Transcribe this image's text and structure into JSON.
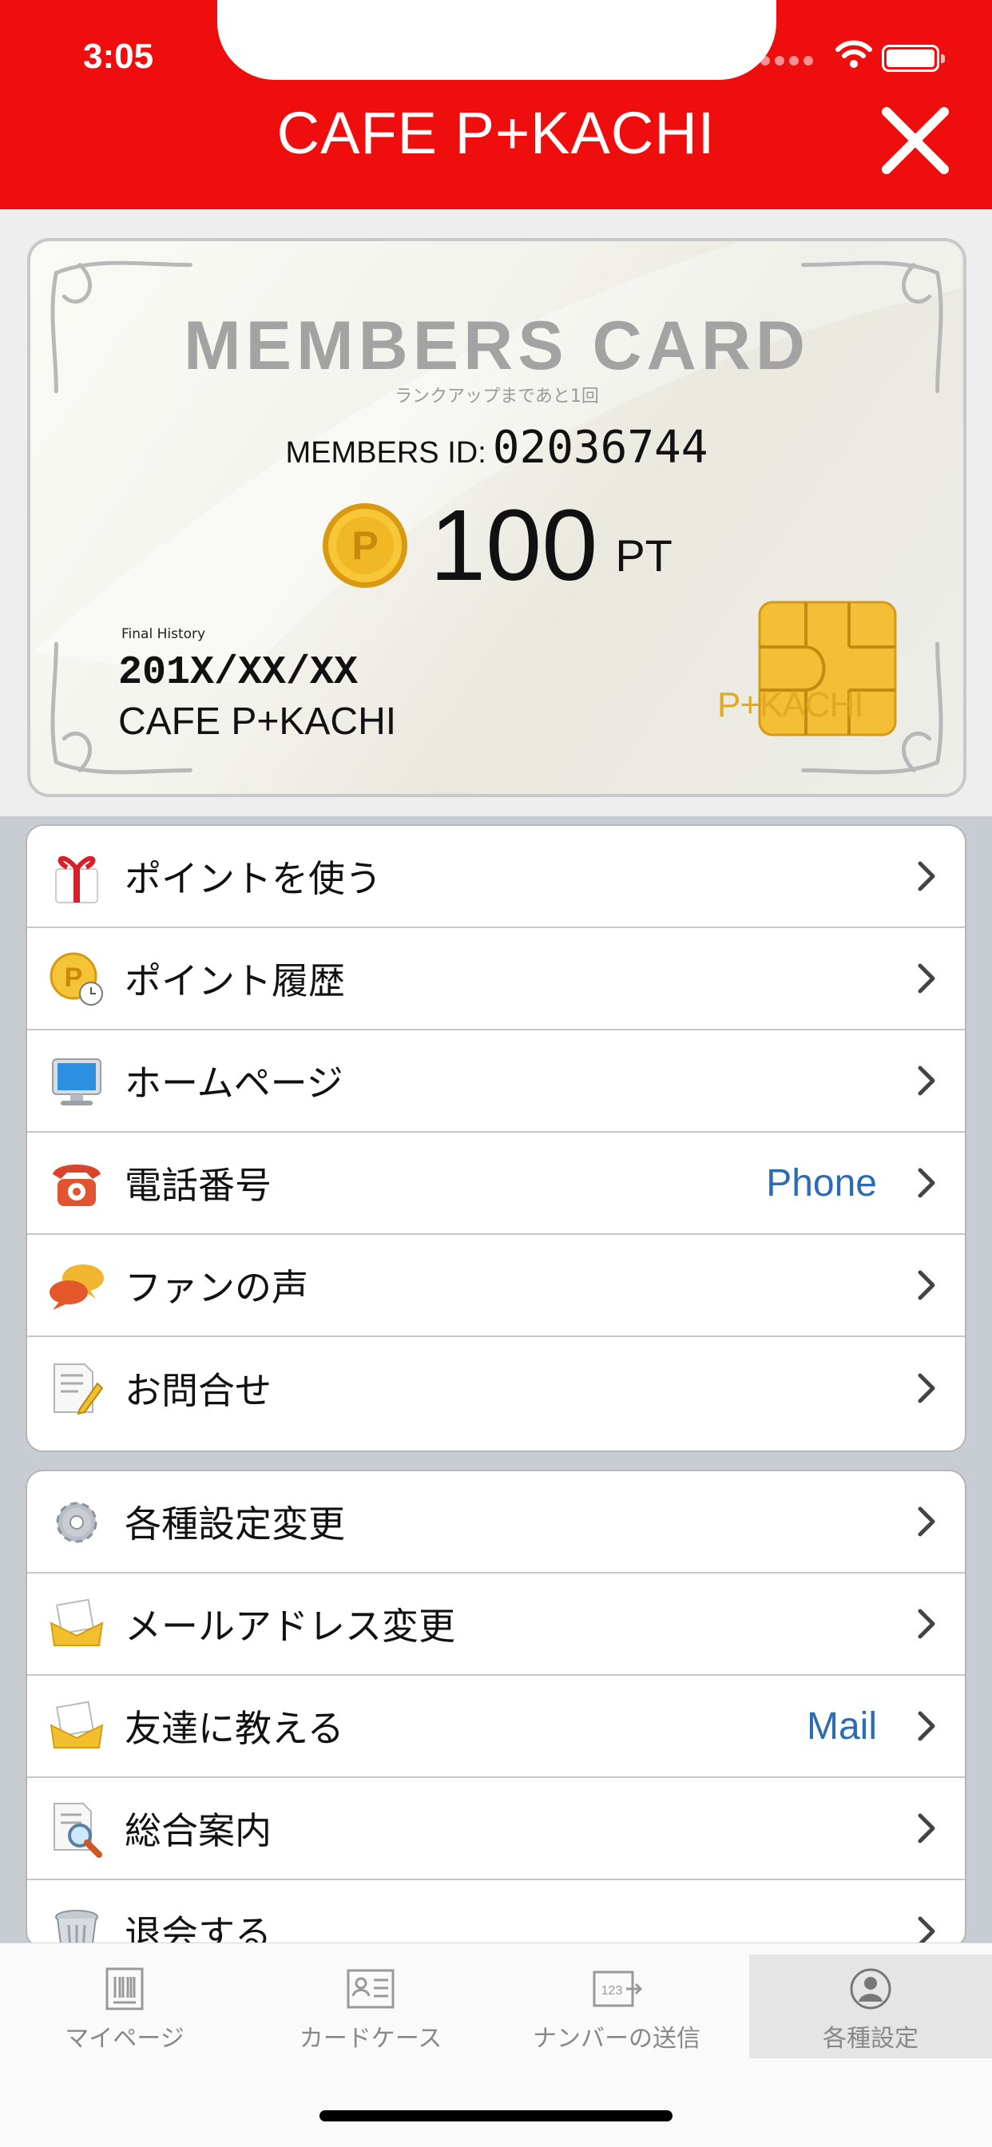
{
  "status_bar": {
    "time": "3:05"
  },
  "header": {
    "title": "CAFE P+KACHI"
  },
  "card": {
    "title": "MEMBERS CARD",
    "subtitle": "ランクアップまであと1回",
    "member_id_label": "MEMBERS ID:",
    "member_id": "02036744",
    "points": "100",
    "points_unit": "PT",
    "coin_letter": "P",
    "final_history_label": "Final History",
    "final_history_date": "201X/XX/XX",
    "final_history_shop": "CAFE P+KACHI",
    "chip_text": "P+KACHI"
  },
  "menu_group_1": [
    {
      "label": "ポイントを使う",
      "icon": "gift-icon"
    },
    {
      "label": "ポイント履歴",
      "icon": "point-history-icon"
    },
    {
      "label": "ホームページ",
      "icon": "monitor-icon"
    },
    {
      "label": "電話番号",
      "value": "Phone",
      "icon": "telephone-icon"
    },
    {
      "label": "ファンの声",
      "icon": "speech-bubbles-icon"
    },
    {
      "label": "お問合せ",
      "icon": "memo-pencil-icon"
    }
  ],
  "menu_group_2": [
    {
      "label": "各種設定変更",
      "icon": "gear-icon"
    },
    {
      "label": "メールアドレス変更",
      "icon": "mail-icon"
    },
    {
      "label": "友達に教える",
      "value": "Mail",
      "icon": "mail-icon"
    },
    {
      "label": "総合案内",
      "icon": "magnifier-document-icon"
    },
    {
      "label": "退会する",
      "icon": "trash-icon"
    }
  ],
  "tabbar": [
    {
      "label": "マイページ",
      "icon": "barcode-card-icon"
    },
    {
      "label": "カードケース",
      "icon": "id-card-icon"
    },
    {
      "label": "ナンバーの送信",
      "icon": "number-send-icon"
    },
    {
      "label": "各種設定",
      "icon": "person-icon",
      "active": true
    }
  ],
  "colors": {
    "header_red": "#ee0e0e",
    "link_blue": "#2b6cb3",
    "chip_gold": "#e2aa23"
  }
}
